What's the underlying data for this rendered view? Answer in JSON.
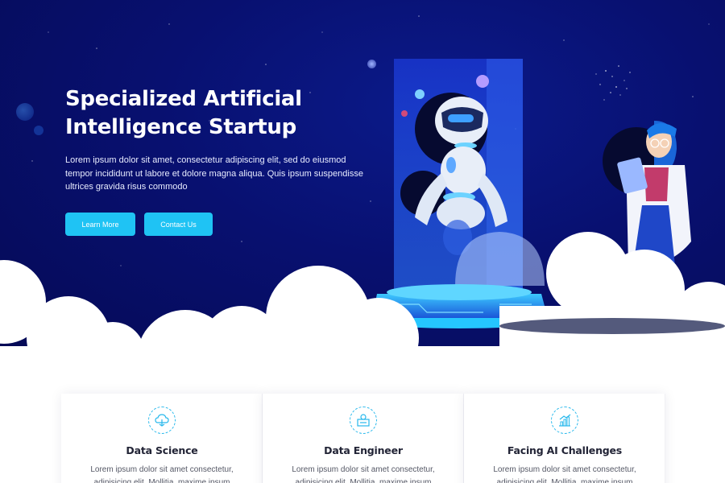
{
  "hero": {
    "title": "Specialized Artificial Intelligence Startup",
    "description": "Lorem ipsum dolor sit amet, consectetur adipiscing elit, sed do eiusmod tempor incididunt ut labore et dolore magna aliqua. Quis ipsum suspendisse ultrices gravida risus commodo",
    "learn_more_label": "Learn More",
    "contact_label": "Contact Us"
  },
  "colors": {
    "hero_bg": "#081070",
    "accent": "#1fc3f4",
    "cloud": "#ffffff"
  },
  "cards": [
    {
      "icon": "cloud-icon",
      "title": "Data Science",
      "text": "Lorem ipsum dolor sit amet consectetur, adipisicing elit. Mollitia, maxime ipsum praesentium culpa"
    },
    {
      "icon": "data-engineer-icon",
      "title": "Data Engineer",
      "text": "Lorem ipsum dolor sit amet consectetur, adipisicing elit. Mollitia, maxime ipsum praesentium culpa"
    },
    {
      "icon": "chart-growth-icon",
      "title": "Facing AI Challenges",
      "text": "Lorem ipsum dolor sit amet consectetur, adipisicing elit. Mollitia, maxime ipsum praesentium culpa"
    }
  ]
}
